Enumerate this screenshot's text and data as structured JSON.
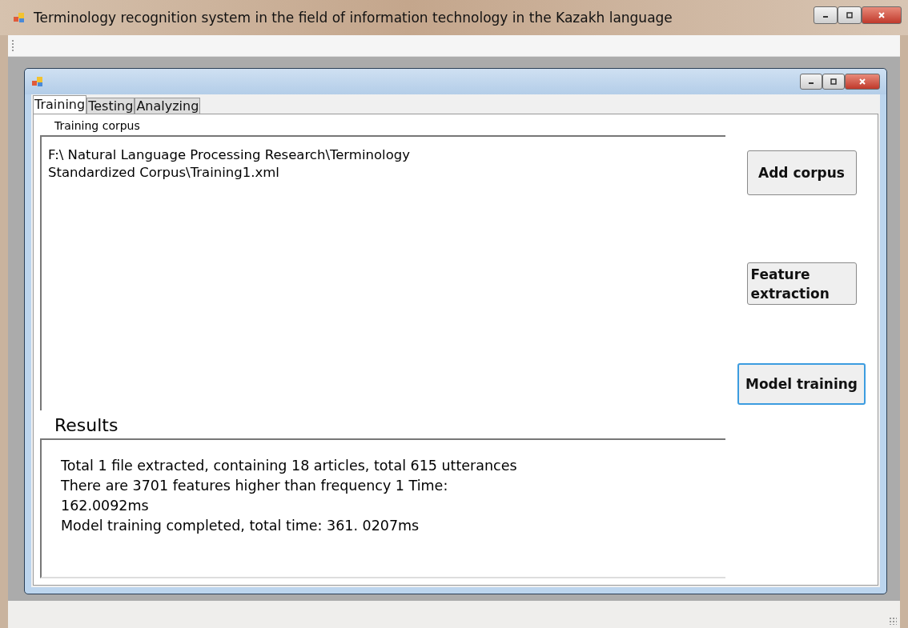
{
  "window": {
    "title": "Terminology recognition system in the field of information technology in the Kazakh language"
  },
  "tabs": [
    {
      "label": "Training",
      "selected": true
    },
    {
      "label": "Testing",
      "selected": false
    },
    {
      "label": "Analyzing",
      "selected": false
    }
  ],
  "corpus": {
    "label": "Training corpus",
    "lines": [
      "F:\\ Natural Language Processing Research\\Terminology",
      "Standardized Corpus\\Training1.xml"
    ]
  },
  "buttons": [
    {
      "label": "Add corpus",
      "focused": false
    },
    {
      "label": "Feature extraction",
      "focused": false
    },
    {
      "label": "Model training",
      "focused": true
    }
  ],
  "results": {
    "label": "Results",
    "lines": [
      "Total 1 file extracted, containing 18 articles, total 615 utterances",
      "There are 3701 features higher than frequency 1 Time:",
      "162.0092ms",
      "Model training completed, total time: 361. 0207ms"
    ]
  }
}
